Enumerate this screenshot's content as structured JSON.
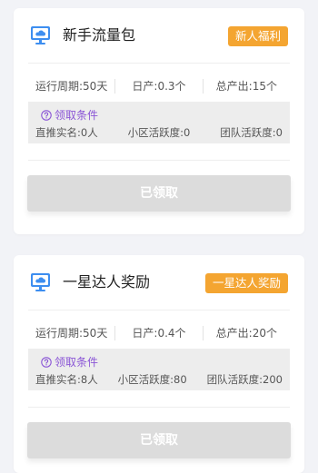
{
  "cards": [
    {
      "title": "新手流量包",
      "badge": "新人福利",
      "stats": [
        "运行周期:50天",
        "日产:0.3个",
        "总产出:15个"
      ],
      "conditions_title": "领取条件",
      "conditions": [
        "直推实名:0人",
        "小区活跃度:0",
        "团队活跃度:0"
      ],
      "button": "已领取"
    },
    {
      "title": "一星达人奖励",
      "badge": "一星达人奖励",
      "stats": [
        "运行周期:50天",
        "日产:0.4个",
        "总产出:20个"
      ],
      "conditions_title": "领取条件",
      "conditions": [
        "直推实名:8人",
        "小区活跃度:80",
        "团队活跃度:200"
      ],
      "button": "已领取"
    }
  ],
  "colors": {
    "background": "#f2f3f7",
    "badge": "#f4a531",
    "conditions_accent": "#8a55d6",
    "claimed_button": "#dcdcdc",
    "icon_blue": "#3d8ef0"
  },
  "icons": {
    "card_icon": "monitor-cloud-icon",
    "conditions_icon": "question-circle-icon"
  }
}
